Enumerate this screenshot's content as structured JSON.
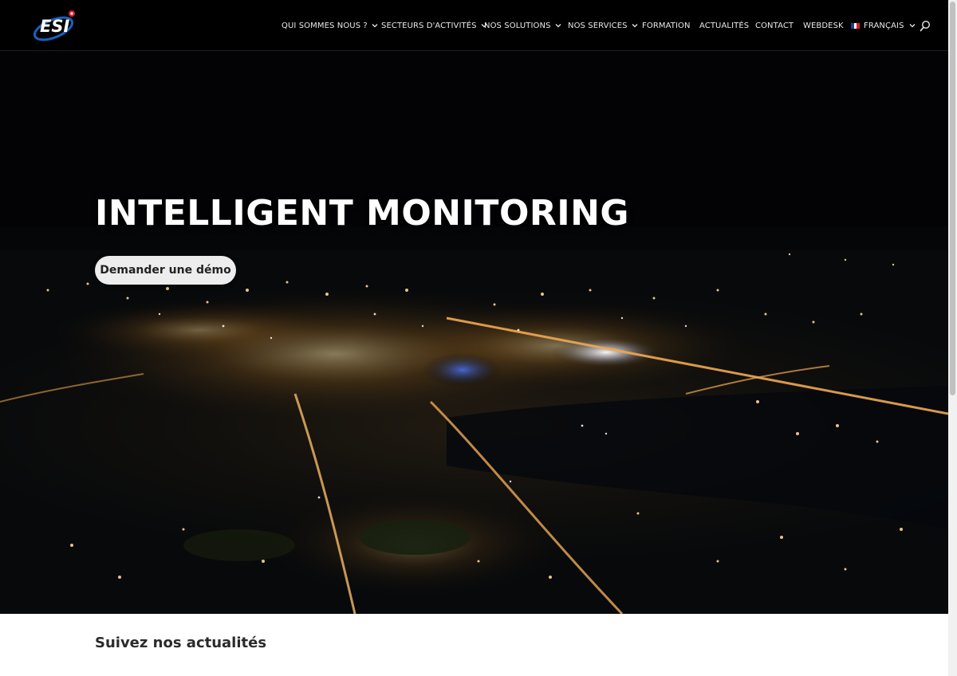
{
  "header": {
    "logo_text": "ESI",
    "nav": [
      {
        "label": "QUI SOMMES NOUS ?",
        "has_dropdown": true
      },
      {
        "label": "SECTEURS D'ACTIVITÉS",
        "has_dropdown": true
      },
      {
        "label": "NOS SOLUTIONS",
        "has_dropdown": true
      },
      {
        "label": "NOS SERVICES",
        "has_dropdown": true
      },
      {
        "label": "FORMATION",
        "has_dropdown": false
      },
      {
        "label": "ACTUALITÉS",
        "has_dropdown": false
      },
      {
        "label": "CONTACT",
        "has_dropdown": false
      },
      {
        "label": "WEBDESK",
        "has_dropdown": false
      }
    ],
    "language": {
      "label": "FRANÇAIS",
      "flag": "fr-flag-icon",
      "has_dropdown": true
    },
    "search_icon": "search-icon"
  },
  "hero": {
    "title": "INTELLIGENT MONITORING",
    "button_label": "Demander une démo"
  },
  "news": {
    "heading": "Suivez nos actualités"
  },
  "colors": {
    "header_bg": "#000000",
    "nav_text": "#e8e8e8",
    "logo_blue": "#1b5fbf",
    "logo_red": "#d6202c",
    "button_bg": "#ededed",
    "heading_text": "#2b2b2b"
  }
}
